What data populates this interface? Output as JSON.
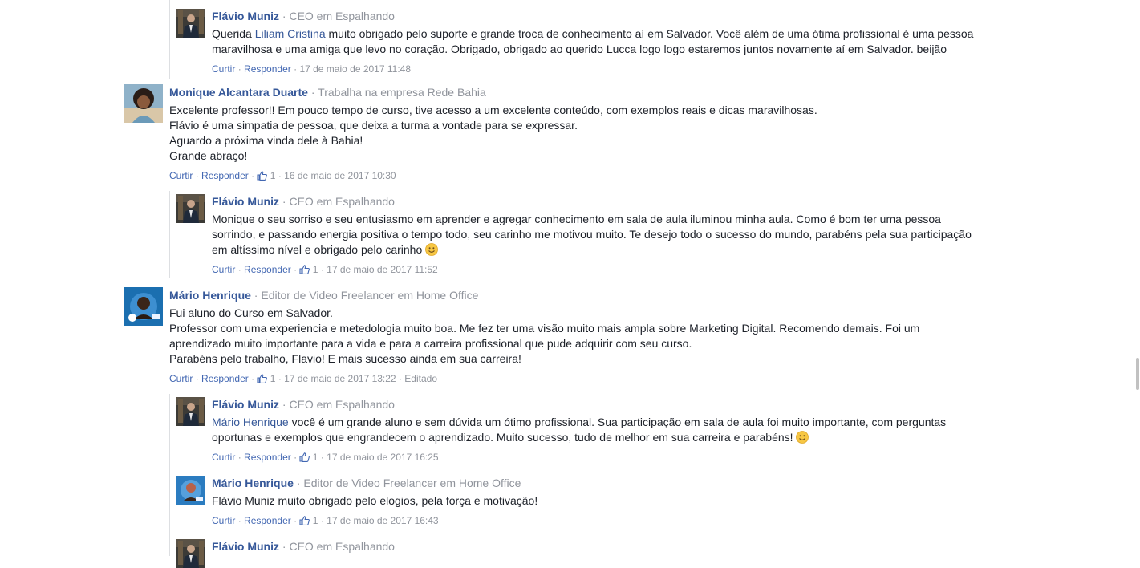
{
  "colors": {
    "link": "#365899",
    "meta": "#90949c",
    "action": "#4267b2",
    "text": "#1d2129"
  },
  "separator": "·",
  "comments": [
    {
      "name": "Flávio Muniz",
      "role": "CEO em Espalhando",
      "avatar_icon": "profile-photo-suit",
      "lines": [
        {
          "mention": "Liliam Cristina",
          "text": " muito obrigado pelo suporte e grande troca de conhecimento aí em Salvador. Você além de uma ótima profissional é uma pessoa",
          "prefix": "Querida "
        },
        {
          "text": "maravilhosa e uma amiga que levo no coração. Obrigado, obrigado ao querido Lucca logo logo estaremos juntos novamente aí em Salvador. beijão"
        }
      ],
      "actions": {
        "like": "Curtir",
        "reply": "Responder",
        "likes": "",
        "date": "17 de maio de 2017 11:48"
      }
    },
    {
      "name": "Monique Alcantara Duarte",
      "role": "Trabalha na empresa Rede Bahia",
      "avatar_icon": "profile-photo-woman",
      "lines": [
        {
          "text": "Excelente professor!! Em pouco tempo de curso, tive acesso a um excelente conteúdo, com exemplos reais e dicas maravilhosas."
        },
        {
          "text": "Flávio é uma simpatia de pessoa, que deixa a turma a vontade para se expressar."
        },
        {
          "text": "Aguardo a próxima vinda dele à Bahia!"
        },
        {
          "text": "Grande abraço!"
        }
      ],
      "actions": {
        "like": "Curtir",
        "reply": "Responder",
        "likes": "1",
        "date": "16 de maio de 2017 10:30"
      }
    },
    {
      "name": "Flávio Muniz",
      "role": "CEO em Espalhando",
      "avatar_icon": "profile-photo-suit",
      "lines": [
        {
          "text": "Monique o seu sorriso e seu entusiasmo em aprender e agregar conhecimento em sala de aula iluminou minha aula. Como é bom ter uma pessoa"
        },
        {
          "text": "sorrindo, e passando energia positiva o tempo todo, seu carinho me motivou muito. Te desejo todo o sucesso do mundo, parabéns pela sua participação"
        },
        {
          "text": "em altíssimo nível e obrigado pelo carinho ",
          "emoji": true
        }
      ],
      "actions": {
        "like": "Curtir",
        "reply": "Responder",
        "likes": "1",
        "date": "17 de maio de 2017 11:52"
      }
    },
    {
      "name": "Mário Henrique",
      "role": "Editor de Video Freelancer em Home Office",
      "avatar_icon": "profile-photo-man-blue",
      "lines": [
        {
          "text": "Fui aluno do Curso em Salvador."
        },
        {
          "text": "Professor com uma experiencia e metedologia muito boa. Me fez ter uma visão muito mais ampla sobre Marketing Digital. Recomendo demais. Foi um"
        },
        {
          "text": "aprendizado muito importante para a vida e para a carreira profissional que pude adquirir com seu curso."
        },
        {
          "text": "Parabéns pelo trabalho, Flavio! E mais sucesso ainda em sua carreira!"
        }
      ],
      "actions": {
        "like": "Curtir",
        "reply": "Responder",
        "likes": "1",
        "date": "17 de maio de 2017 13:22",
        "edited": "Editado"
      }
    },
    {
      "name": "Flávio Muniz",
      "role": "CEO em Espalhando",
      "avatar_icon": "profile-photo-suit",
      "lines": [
        {
          "prefix": "",
          "mention": "Mário Henrique",
          "text": " você é um grande aluno e sem dúvida um ótimo profissional. Sua participação em sala de aula foi muito importante, com perguntas"
        },
        {
          "text": "oportunas e exemplos que engrandecem o aprendizado. Muito sucesso, tudo de melhor em sua carreira e parabéns! ",
          "emoji": true
        }
      ],
      "actions": {
        "like": "Curtir",
        "reply": "Responder",
        "likes": "1",
        "date": "17 de maio de 2017 16:25"
      }
    },
    {
      "name": "Mário Henrique",
      "role": "Editor de Video Freelancer em Home Office",
      "avatar_icon": "profile-photo-man-blue",
      "lines": [
        {
          "text": "Flávio Muniz muito obrigado pelo elogios, pela força e motivação!"
        }
      ],
      "actions": {
        "like": "Curtir",
        "reply": "Responder",
        "likes": "1",
        "date": "17 de maio de 2017 16:43"
      }
    },
    {
      "name": "Flávio Muniz",
      "role": "CEO em Espalhando",
      "avatar_icon": "profile-photo-suit",
      "lines": [],
      "actions": null
    }
  ]
}
